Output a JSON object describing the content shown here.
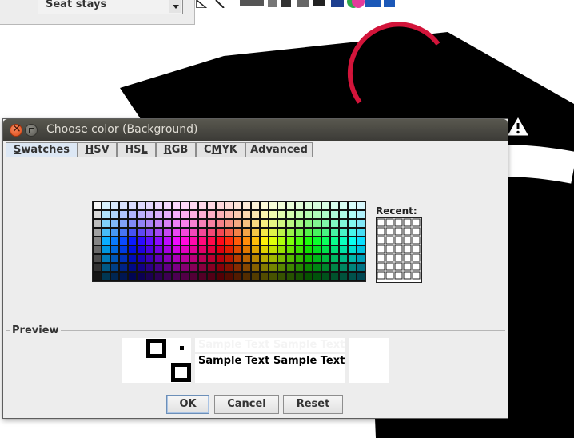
{
  "window": {
    "title": "Choose color (Background)"
  },
  "background_panel": {
    "combo_value": "Seat stays"
  },
  "tabs": [
    {
      "label": "Swatches",
      "mnemonic": 0,
      "selected": true
    },
    {
      "label": "HSV",
      "mnemonic": 0,
      "selected": false
    },
    {
      "label": "HSL",
      "mnemonic": 2,
      "selected": false
    },
    {
      "label": "RGB",
      "mnemonic": 0,
      "selected": false
    },
    {
      "label": "CMYK",
      "mnemonic": 1,
      "selected": false
    },
    {
      "label": "Advanced",
      "mnemonic": -1,
      "selected": false
    }
  ],
  "swatches": {
    "recent_label": "Recent:"
  },
  "preview": {
    "label": "Preview",
    "sample_text": "Sample Text"
  },
  "buttons": {
    "ok": "OK",
    "cancel": "Cancel",
    "reset": "Reset"
  },
  "icons": {
    "warning": "warning-triangle-icon",
    "close": "close-icon",
    "maximize": "maximize-icon"
  }
}
